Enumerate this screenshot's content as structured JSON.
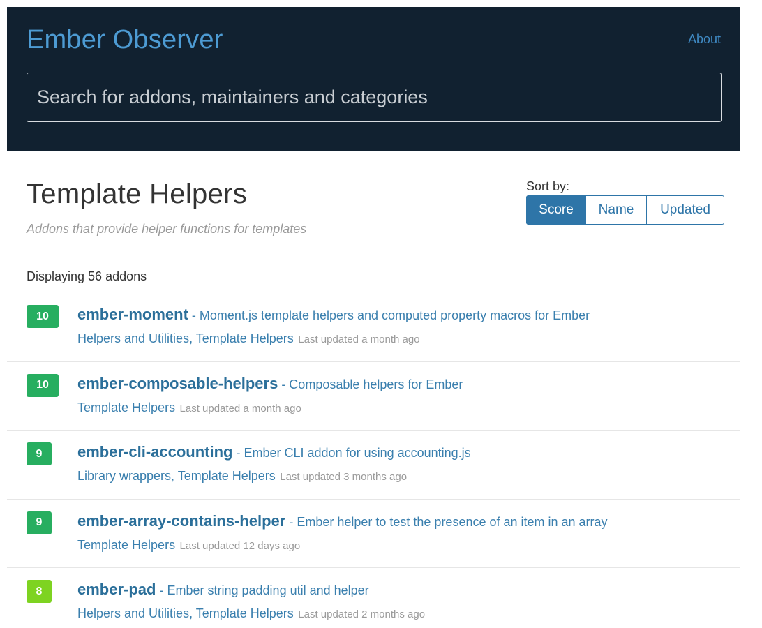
{
  "header": {
    "site_title": "Ember Observer",
    "about_label": "About",
    "search_placeholder": "Search for addons, maintainers and categories"
  },
  "category": {
    "title": "Template Helpers",
    "subtitle": "Addons that provide helper functions for templates"
  },
  "sort": {
    "label": "Sort by:",
    "options": [
      "Score",
      "Name",
      "Updated"
    ],
    "selected": "Score",
    "active_color": "#2e75a8"
  },
  "count_text": "Displaying 56 addons",
  "colors": {
    "header_bg": "#112130",
    "score_high": "#27ae60",
    "score_mid": "#7ed321",
    "link": "#2b6f9a"
  },
  "addons": [
    {
      "score": "10",
      "name": "ember-moment",
      "description": " - Moment.js template helpers and computed property macros for Ember",
      "categories": "Helpers and Utilities, Template Helpers",
      "updated": "Last updated a month ago"
    },
    {
      "score": "10",
      "name": "ember-composable-helpers",
      "description": " - Composable helpers for Ember",
      "categories": "Template Helpers",
      "updated": "Last updated a month ago"
    },
    {
      "score": "9",
      "name": "ember-cli-accounting",
      "description": " - Ember CLI addon for using accounting.js",
      "categories": "Library wrappers, Template Helpers",
      "updated": "Last updated 3 months ago"
    },
    {
      "score": "9",
      "name": "ember-array-contains-helper",
      "description": " - Ember helper to test the presence of an item in an array",
      "categories": "Template Helpers",
      "updated": "Last updated 12 days ago"
    },
    {
      "score": "8",
      "name": "ember-pad",
      "description": " - Ember string padding util and helper",
      "categories": "Helpers and Utilities, Template Helpers",
      "updated": "Last updated 2 months ago"
    }
  ]
}
